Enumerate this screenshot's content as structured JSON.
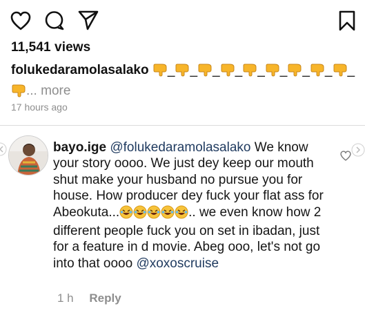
{
  "actions": {
    "like_icon": "heart-outline-icon",
    "comment_icon": "comment-bubble-icon",
    "share_icon": "paper-plane-icon",
    "save_icon": "bookmark-icon"
  },
  "post": {
    "views": "11,541 views",
    "username": "folukedaramolasalako",
    "caption_separators": [
      "_",
      "_",
      "_",
      "_",
      "_",
      "_",
      "_",
      "_",
      "_"
    ],
    "more_label": "... more",
    "timestamp": "17 hours ago",
    "caption_emoji": "pointing-down-hand-emoji"
  },
  "comment": {
    "username": "bayo.ige",
    "mention": "@folukedaramolasalako",
    "text_part1": " We know your story oooo. We just dey keep our mouth shut make your husband no pursue you for house. How producer dey fuck your flat ass for Abeokuta...",
    "text_part2": "..  we even know how 2 different people fuck you on set in ibadan, just for a feature in d movie. Abeg ooo, let's not go into that oooo",
    "mention2": "@xoxoscruise",
    "laugh_emoji": "rolling-on-floor-laughing-emoji",
    "age": "1 h",
    "reply_label": "Reply"
  },
  "colors": {
    "text": "#111111",
    "muted": "#8e8e8e",
    "divider": "#dbdbdb",
    "emoji_yellow": "#f7b52a"
  }
}
